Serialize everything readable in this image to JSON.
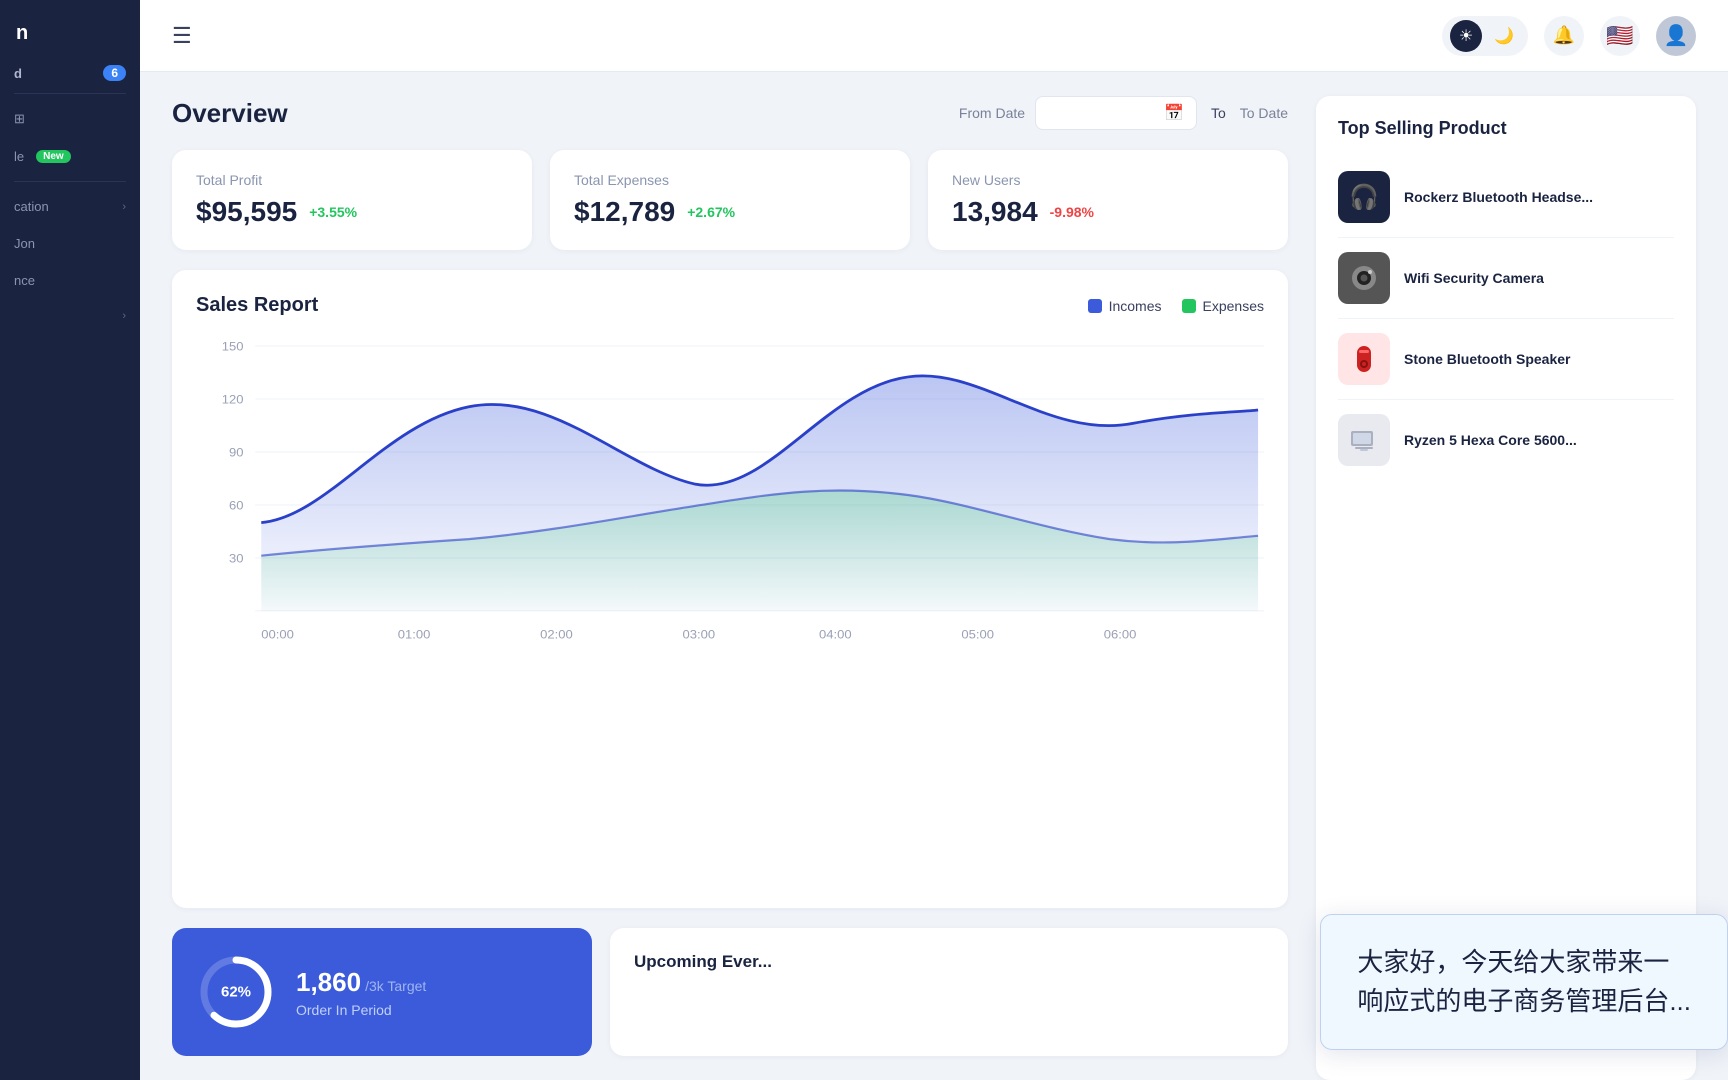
{
  "app": {
    "url": "127.0.0.1:5500/backend/index.html"
  },
  "sidebar": {
    "logo": "n",
    "nav_badge_label": "d",
    "nav_badge_count": "6",
    "items": [
      {
        "id": "dashboard",
        "label": "",
        "has_arrow": false
      },
      {
        "id": "products",
        "label": "le",
        "has_arrow": false,
        "has_new": true
      },
      {
        "id": "location",
        "label": "cation",
        "has_arrow": true
      },
      {
        "id": "jon",
        "label": "Jon",
        "has_arrow": false
      },
      {
        "id": "ice",
        "label": "nce",
        "has_arrow": false
      },
      {
        "id": "extra",
        "label": "",
        "has_arrow": true
      }
    ]
  },
  "topbar": {
    "menu_icon": "☰",
    "theme_light_icon": "☀",
    "theme_dark_icon": "🌙",
    "notification_icon": "🔔",
    "flag_icon": "🇺🇸",
    "avatar_icon": "👤"
  },
  "overview": {
    "title": "Overview",
    "from_date_label": "From Date",
    "to_label": "To",
    "to_date_label": "To Date",
    "from_date_value": "",
    "to_date_value": ""
  },
  "stats": [
    {
      "id": "total-profit",
      "label": "Total Profit",
      "value": "$95,595",
      "change": "+3.55%",
      "positive": true
    },
    {
      "id": "total-expenses",
      "label": "Total Expenses",
      "value": "$12,789",
      "change": "+2.67%",
      "positive": true
    },
    {
      "id": "new-users",
      "label": "New Users",
      "value": "13,984",
      "change": "-9.98%",
      "positive": false
    }
  ],
  "sales_report": {
    "title": "Sales Report",
    "legend": [
      {
        "id": "incomes",
        "label": "Incomes",
        "color": "#3b5bdb"
      },
      {
        "id": "expenses",
        "label": "Expenses",
        "color": "#22c55e"
      }
    ],
    "y_labels": [
      "150",
      "120",
      "90",
      "60",
      "30"
    ],
    "x_labels": [
      "00:00",
      "01:00",
      "02:00",
      "03:00",
      "04:00",
      "05:00",
      "06:00"
    ]
  },
  "order_card": {
    "progress_pct": 62,
    "progress_label": "62%",
    "count": "1,860",
    "target": "/3k Target",
    "sublabel": "Order In Period"
  },
  "upcoming": {
    "title": "Upcoming Ever..."
  },
  "top_selling": {
    "title": "Top Selling Product",
    "products": [
      {
        "id": "rockerz",
        "name": "Rockerz Bluetooth Headse...",
        "icon_char": "🎧",
        "icon_bg": "#1a2340"
      },
      {
        "id": "wifi-camera",
        "name": "Wifi Security Camera",
        "icon_char": "📷",
        "icon_bg": "#555"
      },
      {
        "id": "stone-speaker",
        "name": "Stone Bluetooth Speaker",
        "icon_char": "🔴",
        "icon_bg": "#c00"
      },
      {
        "id": "ryzen",
        "name": "Ryzen 5 Hexa Core 5600...",
        "icon_char": "💻",
        "icon_bg": "#888"
      }
    ]
  },
  "chat_overlay": {
    "text": "大家好，今天给大家带来一\n响应式的电子商务管理后台..."
  }
}
